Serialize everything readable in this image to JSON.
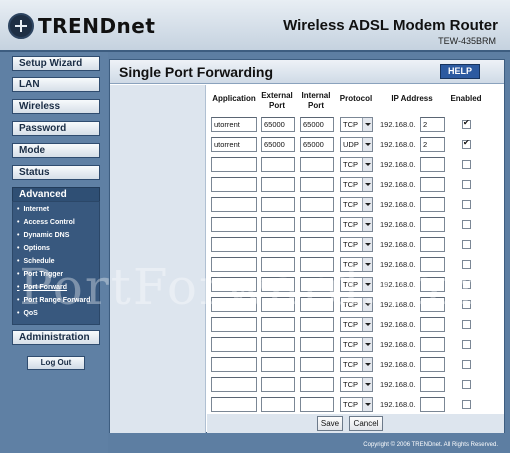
{
  "header": {
    "logo": "TRENDnet",
    "product": "Wireless ADSL Modem Router",
    "model": "TEW-435BRM"
  },
  "sidebar": {
    "nav": [
      "Setup Wizard",
      "LAN",
      "Wireless",
      "Password",
      "Mode",
      "Status",
      "Advanced"
    ],
    "advanced_items": [
      "Internet",
      "Access Control",
      "Dynamic DNS",
      "Options",
      "Schedule",
      "Port Trigger",
      "Port Forward",
      "Port Range Forward",
      "QoS"
    ],
    "active_item": "Port Forward",
    "admin": "Administration",
    "logout": "Log Out"
  },
  "main": {
    "title": "Single Port Forwarding",
    "help": "HELP",
    "headers": {
      "application": "Application",
      "external": "External Port",
      "internal": "Internal Port",
      "protocol": "Protocol",
      "ip": "IP Address",
      "enabled": "Enabled"
    },
    "ip_prefix": "192.168.0.",
    "rows": [
      {
        "app": "utorrent",
        "ext": "65000",
        "int": "65000",
        "proto": "TCP",
        "ip": "2",
        "enabled": true
      },
      {
        "app": "utorrent",
        "ext": "65000",
        "int": "65000",
        "proto": "UDP",
        "ip": "2",
        "enabled": true
      },
      {
        "app": "",
        "ext": "",
        "int": "",
        "proto": "TCP",
        "ip": "",
        "enabled": false
      },
      {
        "app": "",
        "ext": "",
        "int": "",
        "proto": "TCP",
        "ip": "",
        "enabled": false
      },
      {
        "app": "",
        "ext": "",
        "int": "",
        "proto": "TCP",
        "ip": "",
        "enabled": false
      },
      {
        "app": "",
        "ext": "",
        "int": "",
        "proto": "TCP",
        "ip": "",
        "enabled": false
      },
      {
        "app": "",
        "ext": "",
        "int": "",
        "proto": "TCP",
        "ip": "",
        "enabled": false
      },
      {
        "app": "",
        "ext": "",
        "int": "",
        "proto": "TCP",
        "ip": "",
        "enabled": false
      },
      {
        "app": "",
        "ext": "",
        "int": "",
        "proto": "TCP",
        "ip": "",
        "enabled": false
      },
      {
        "app": "",
        "ext": "",
        "int": "",
        "proto": "TCP",
        "ip": "",
        "enabled": false
      },
      {
        "app": "",
        "ext": "",
        "int": "",
        "proto": "TCP",
        "ip": "",
        "enabled": false
      },
      {
        "app": "",
        "ext": "",
        "int": "",
        "proto": "TCP",
        "ip": "",
        "enabled": false
      },
      {
        "app": "",
        "ext": "",
        "int": "",
        "proto": "TCP",
        "ip": "",
        "enabled": false
      },
      {
        "app": "",
        "ext": "",
        "int": "",
        "proto": "TCP",
        "ip": "",
        "enabled": false
      },
      {
        "app": "",
        "ext": "",
        "int": "",
        "proto": "TCP",
        "ip": "",
        "enabled": false
      }
    ],
    "save": "Save",
    "cancel": "Cancel"
  },
  "watermark": "PortForward.com",
  "copyright": "Copyright © 2006 TRENDnet. All Rights Reserved."
}
